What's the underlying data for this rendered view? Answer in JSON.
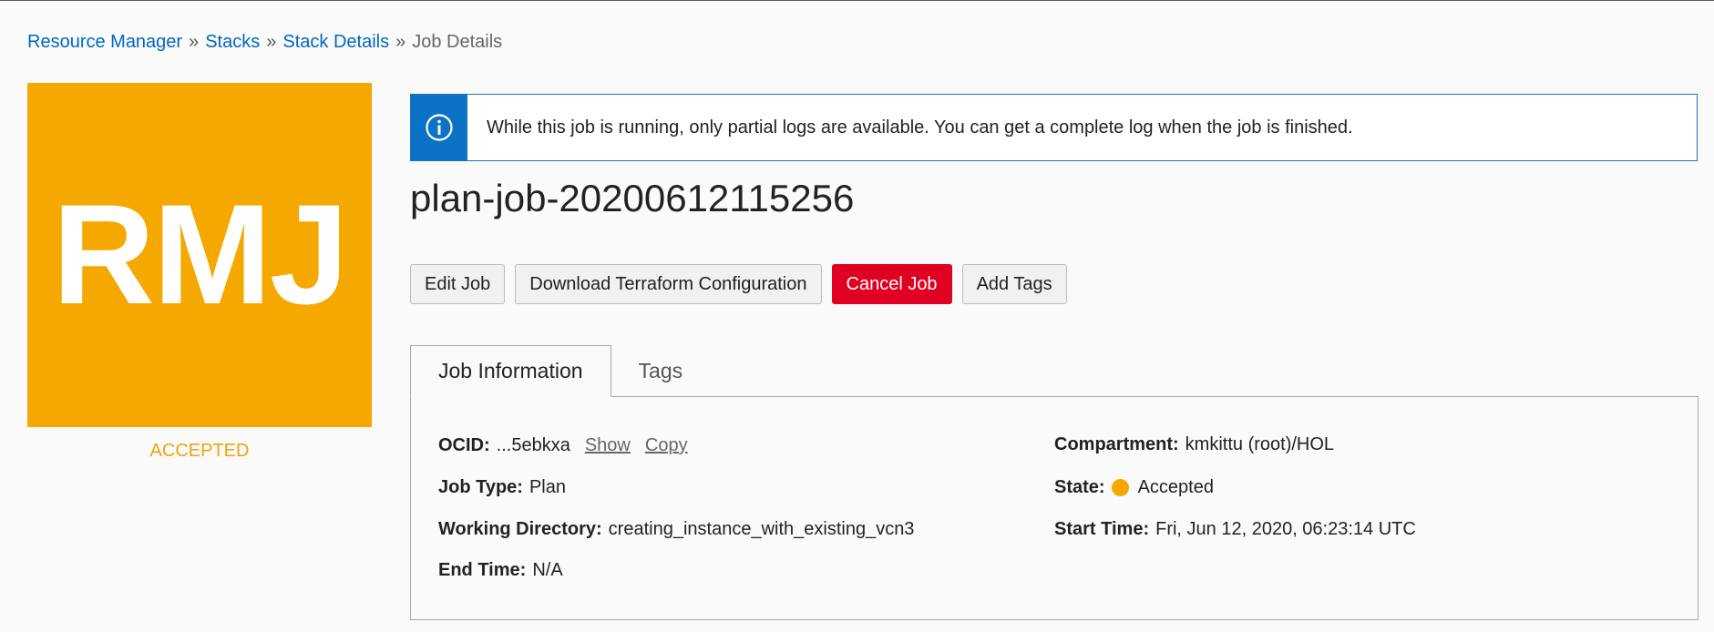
{
  "breadcrumb": {
    "items": [
      "Resource Manager",
      "Stacks",
      "Stack Details"
    ],
    "current": "Job Details",
    "separator": "»"
  },
  "avatar": {
    "initials": "RMJ",
    "status": "ACCEPTED",
    "color": "#f5a800"
  },
  "banner": {
    "icon": "info-icon",
    "message": "While this job is running, only partial logs are available. You can get a complete log when the job is finished."
  },
  "page": {
    "title": "plan-job-20200612115256"
  },
  "actions": {
    "edit_label": "Edit Job",
    "download_label": "Download Terraform Configuration",
    "cancel_label": "Cancel Job",
    "add_tags_label": "Add Tags"
  },
  "tabs": [
    {
      "label": "Job Information",
      "active": true
    },
    {
      "label": "Tags",
      "active": false
    }
  ],
  "details": {
    "ocid": {
      "label": "OCID:",
      "value": "...5ebkxa",
      "show_link": "Show",
      "copy_link": "Copy"
    },
    "job_type": {
      "label": "Job Type:",
      "value": "Plan"
    },
    "working_directory": {
      "label": "Working Directory:",
      "value": "creating_instance_with_existing_vcn3"
    },
    "end_time": {
      "label": "End Time:",
      "value": "N/A"
    },
    "compartment": {
      "label": "Compartment:",
      "value": "kmkittu (root)/HOL"
    },
    "state": {
      "label": "State:",
      "value": "Accepted",
      "color": "#f5a800"
    },
    "start_time": {
      "label": "Start Time:",
      "value": "Fri, Jun 12, 2020, 06:23:14 UTC"
    }
  }
}
